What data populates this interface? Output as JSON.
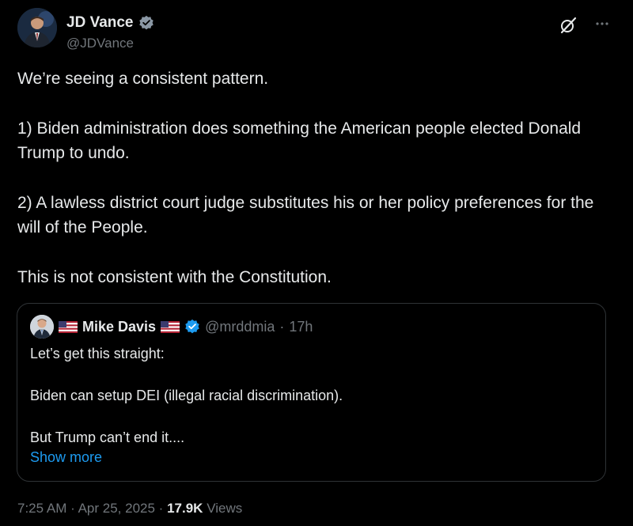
{
  "author": {
    "display_name": "JD Vance",
    "handle": "@JDVance",
    "verified_color": "#8b98a5"
  },
  "post": {
    "paragraphs": [
      "We’re seeing a consistent pattern.",
      "1) Biden administration does something the American people elected Donald Trump to undo.",
      "2) A lawless district court judge substitutes his or her policy preferences for the will of the People.",
      "This is not consistent with the Constitution."
    ]
  },
  "quote": {
    "display_name": "Mike Davis",
    "handle": "@mrddmia",
    "separator": "·",
    "time": "17h",
    "verified_color": "#1d9bf0",
    "paragraphs": [
      "Let’s get this straight:",
      "Biden can setup DEI (illegal racial discrimination).",
      "But Trump can’t end it...."
    ],
    "show_more": "Show more"
  },
  "meta": {
    "time": "7:25 AM",
    "sep1": "·",
    "date": "Apr 25, 2025",
    "sep2": "·",
    "views_count": "17.9K",
    "views_label": "Views"
  },
  "icons": {
    "grok": "grok-icon",
    "more": "more-icon",
    "verified": "verified-badge-icon",
    "flag": "us-flag-icon"
  },
  "colors": {
    "background": "#000000",
    "text": "#e7e9ea",
    "muted": "#71767b",
    "link": "#1d9bf0",
    "border": "#2f3336"
  }
}
